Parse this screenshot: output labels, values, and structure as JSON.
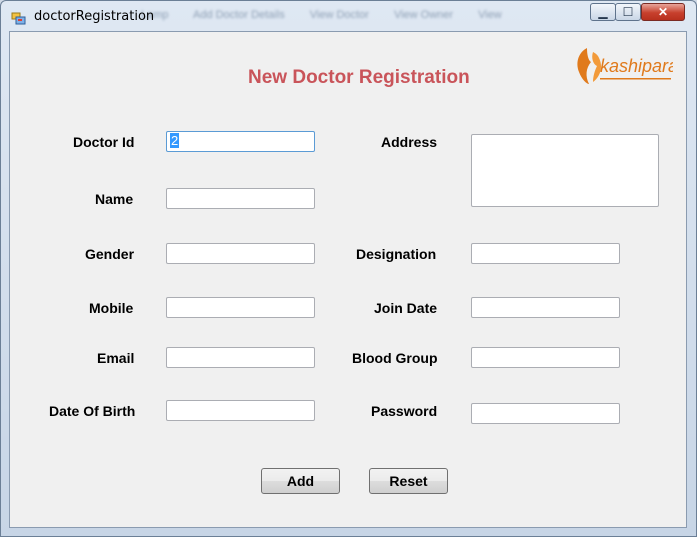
{
  "window": {
    "title": "doctorRegistration",
    "background_menu": [
      "Lamp",
      "Add Doctor Details",
      "View Doctor",
      "View Owner",
      "View"
    ],
    "controls": {
      "minimize": "▁",
      "maximize": "☐",
      "close": "✕"
    }
  },
  "form": {
    "title": "New Doctor Registration",
    "title_color": "#c9545a",
    "logo_text": "kashipara",
    "logo_color": "#e07a1c",
    "labels": {
      "doctor_id": "Doctor Id",
      "name": "Name",
      "gender": "Gender",
      "mobile": "Mobile",
      "email": "Email",
      "date_of_birth": "Date Of Birth",
      "address": "Address",
      "designation": "Designation",
      "join_date": "Join Date",
      "blood_group": "Blood Group",
      "password": "Password"
    },
    "values": {
      "doctor_id": "2",
      "name": "",
      "gender": "",
      "mobile": "",
      "email": "",
      "date_of_birth": "",
      "address": "",
      "designation": "",
      "join_date": "",
      "blood_group": "",
      "password": ""
    },
    "buttons": {
      "add": "Add",
      "reset": "Reset"
    }
  }
}
